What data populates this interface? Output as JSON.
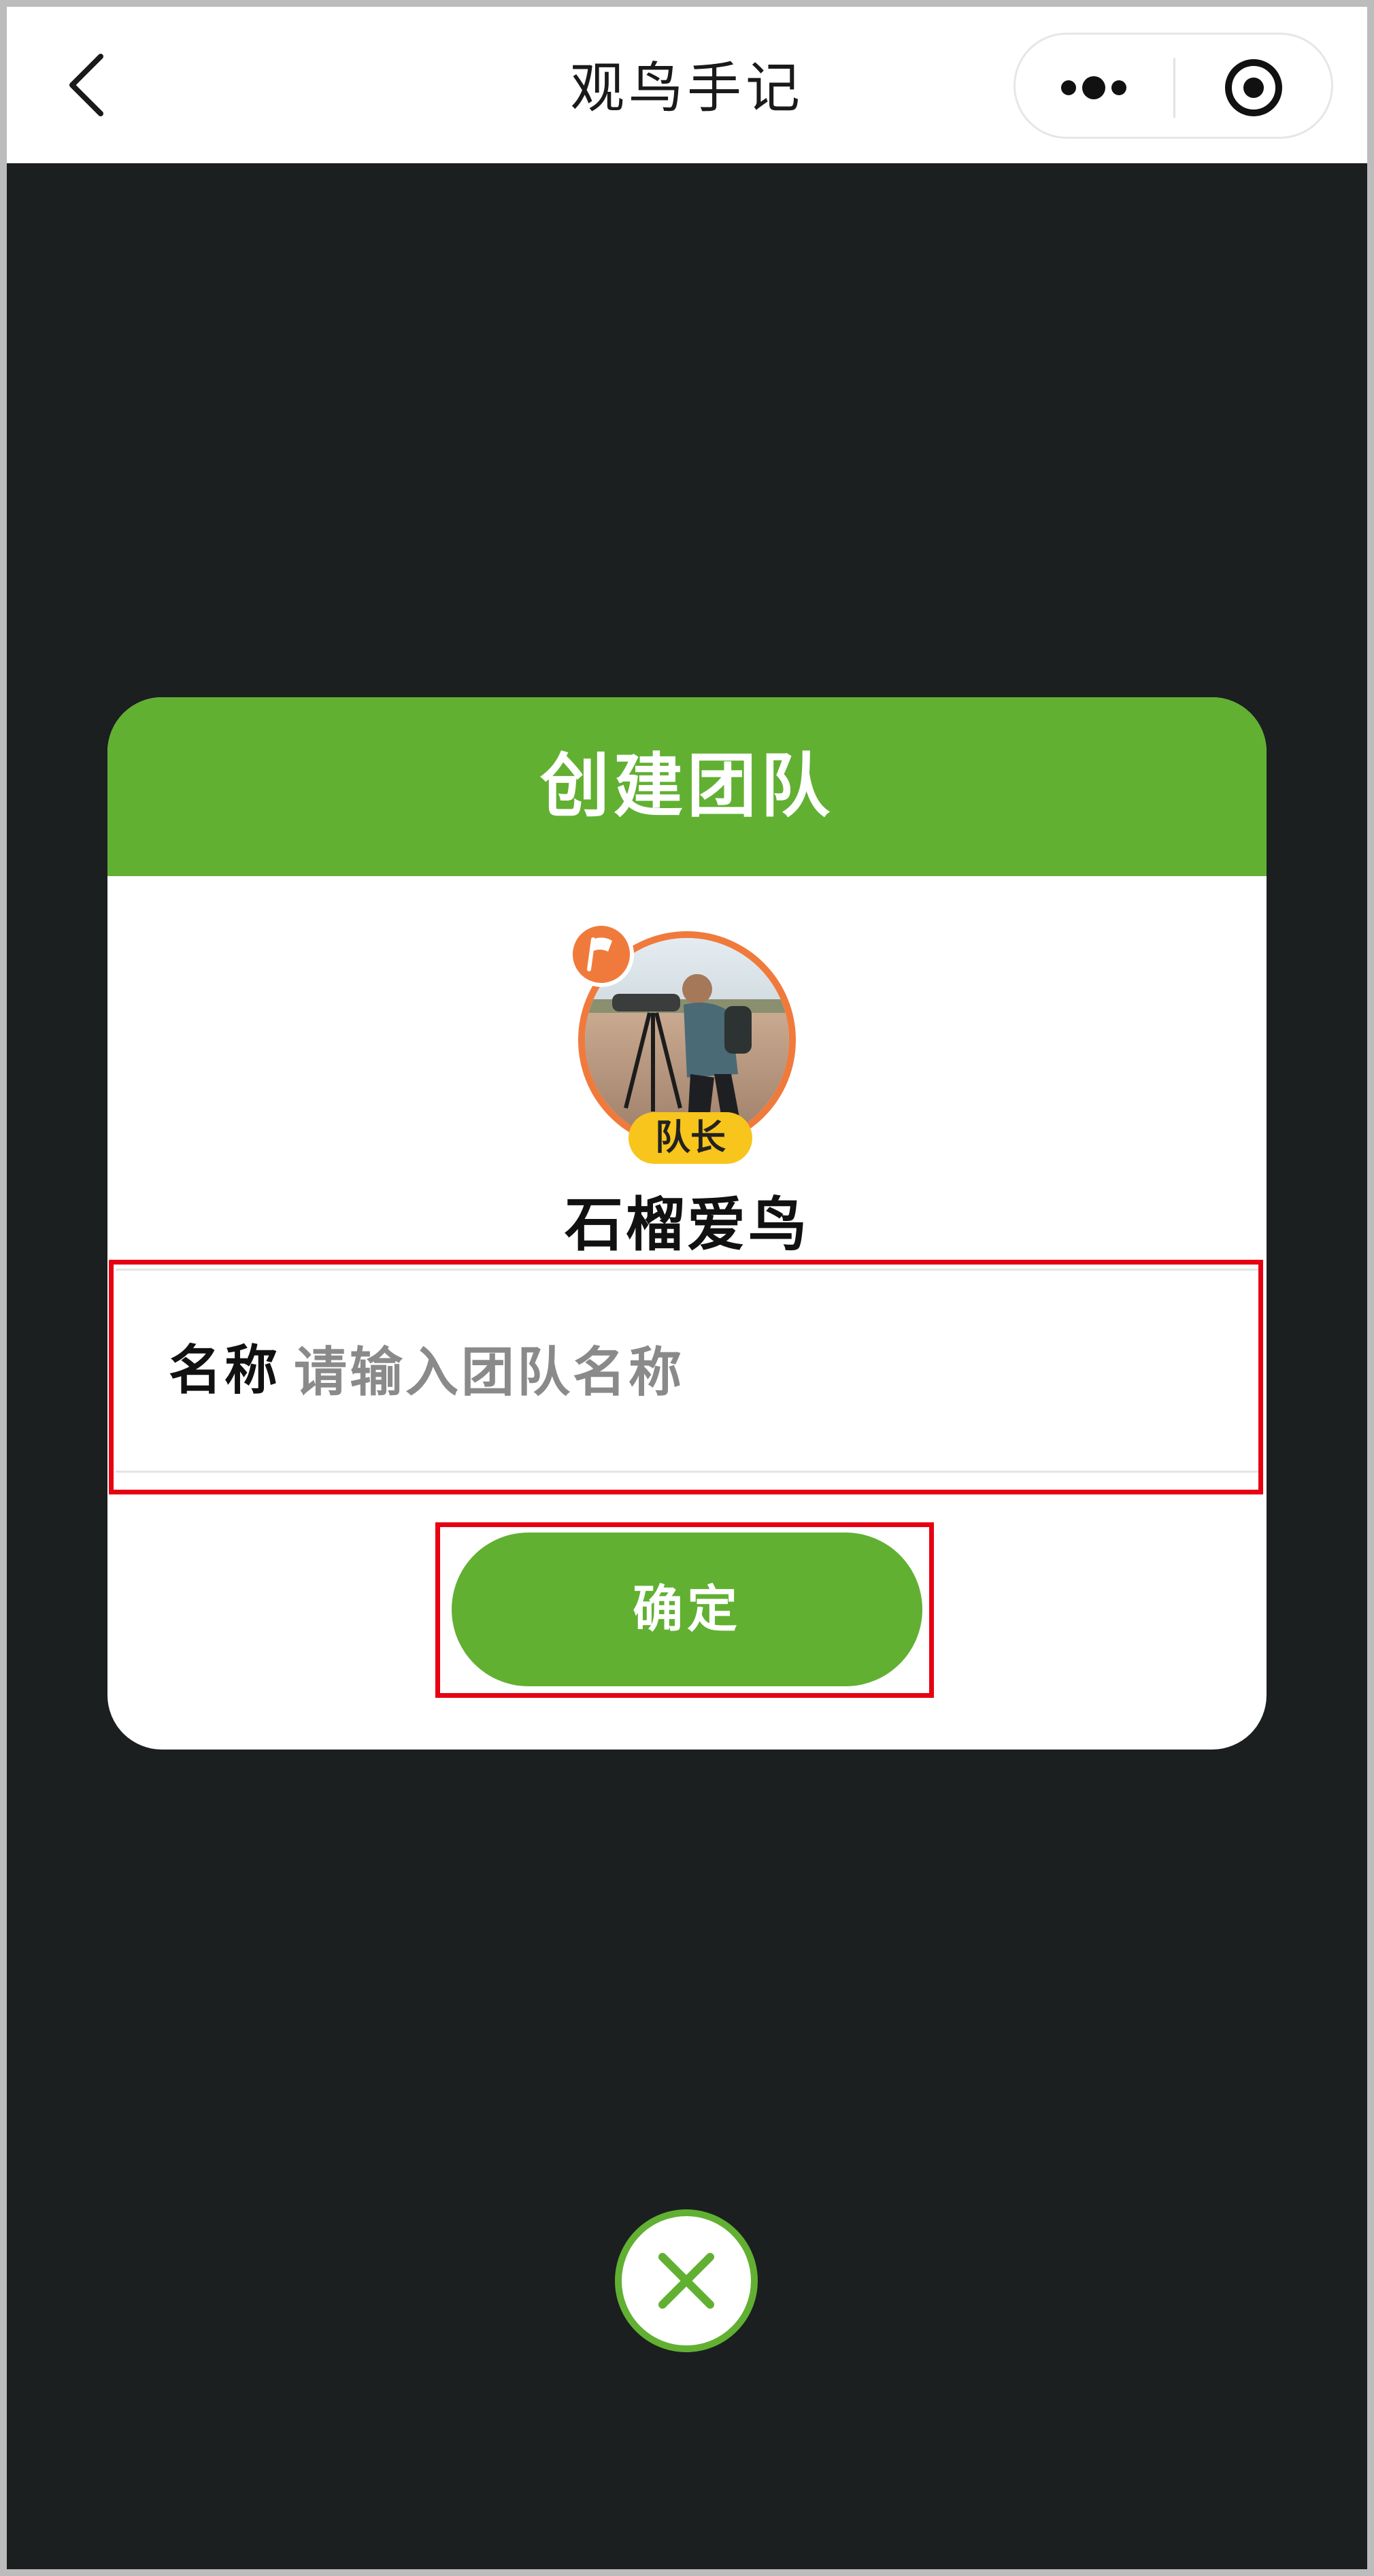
{
  "topbar": {
    "title": "观鸟手记",
    "back_icon": "chevron-left-icon",
    "more_icon": "more-dots-icon",
    "target_icon": "target-circle-icon"
  },
  "dialog": {
    "title": "创建团队",
    "role_badge": "队长",
    "user_name": "石榴爱鸟",
    "field_label": "名称",
    "field_placeholder": "请输入团队名称",
    "field_value": "",
    "confirm_label": "确定",
    "close_icon": "close-icon"
  },
  "colors": {
    "accent_green": "#61b032",
    "overlay": "#1b1f1f",
    "badge_yellow": "#f7c51c",
    "avatar_ring": "#f07a3c",
    "highlight_red": "#e60012"
  }
}
